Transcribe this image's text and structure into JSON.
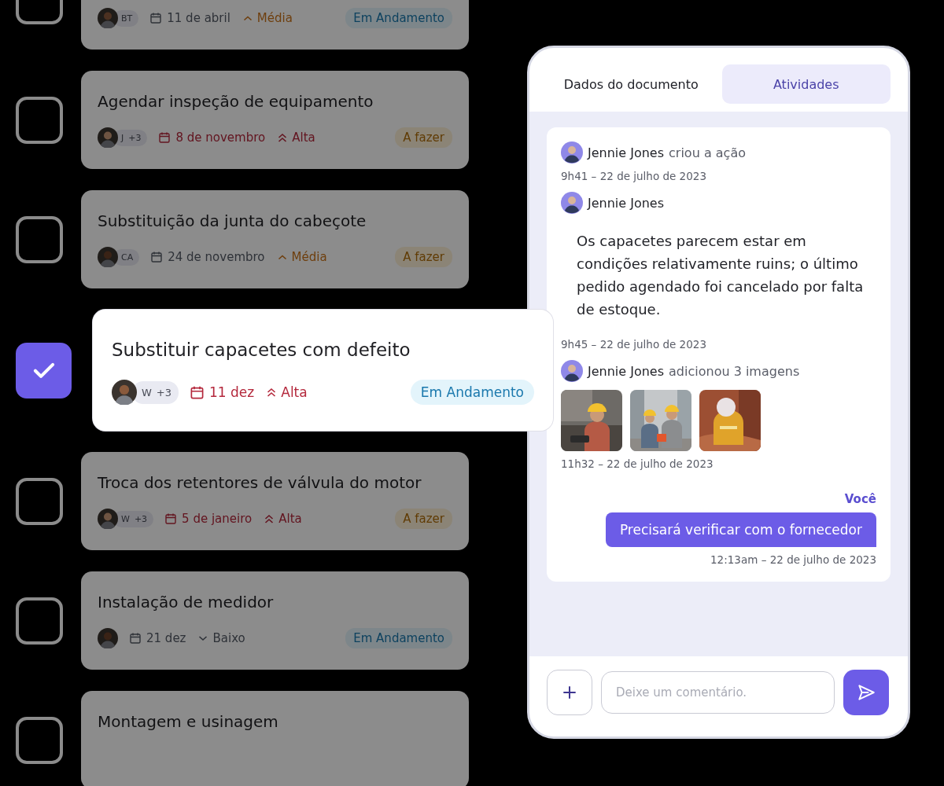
{
  "tasks": [
    {
      "checked": false,
      "selected": false,
      "assignee": {
        "initials": "BT"
      },
      "date": "11 de abril",
      "date_overdue": false,
      "priority": {
        "label": "Média",
        "kind": "medium"
      },
      "status": {
        "label": "Em Andamento",
        "kind": "in_progress"
      }
    },
    {
      "checked": false,
      "selected": false,
      "title": "Agendar inspeção de equipamento",
      "assignee": {
        "initials": "J",
        "extra": "+3"
      },
      "date": "8 de novembro",
      "date_overdue": true,
      "priority": {
        "label": "Alta",
        "kind": "high"
      },
      "status": {
        "label": "A fazer",
        "kind": "todo"
      }
    },
    {
      "checked": false,
      "selected": false,
      "title": "Substituição da junta do cabeçote",
      "assignee": {
        "initials": "CA"
      },
      "date": "24 de novembro",
      "date_overdue": false,
      "priority": {
        "label": "Média",
        "kind": "medium"
      },
      "status": {
        "label": "A fazer",
        "kind": "todo"
      }
    },
    {
      "checked": true,
      "selected": true,
      "title": "Substituir capacetes com defeito",
      "assignee": {
        "initials": "W",
        "extra": "+3"
      },
      "date": "11 dez",
      "date_overdue": true,
      "priority": {
        "label": "Alta",
        "kind": "high"
      },
      "status": {
        "label": "Em Andamento",
        "kind": "in_progress"
      }
    },
    {
      "checked": false,
      "selected": false,
      "title": "Troca dos retentores de válvula do motor",
      "assignee": {
        "initials": "W",
        "extra": "+3"
      },
      "date": "5 de janeiro",
      "date_overdue": true,
      "priority": {
        "label": "Alta",
        "kind": "high"
      },
      "status": {
        "label": "A fazer",
        "kind": "todo"
      }
    },
    {
      "checked": false,
      "selected": false,
      "title": "Instalação de medidor",
      "date": "21 dez",
      "date_overdue": false,
      "priority": {
        "label": "Baixo",
        "kind": "low"
      },
      "status": {
        "label": "Em Andamento",
        "kind": "in_progress"
      }
    },
    {
      "checked": false,
      "selected": false,
      "title": "Montagem e usinagem"
    }
  ],
  "panel": {
    "tabs": [
      {
        "label": "Dados do documento",
        "selected": false
      },
      {
        "label": "Atividades",
        "selected": true
      }
    ],
    "activity": [
      {
        "kind": "event",
        "author": "Jennie Jones",
        "action": "criou a ação",
        "time": "9h41 – 22 de julho de 2023"
      },
      {
        "kind": "comment",
        "author": "Jennie Jones",
        "text": "Os capacetes parecem estar em condições relativamente ruins; o último pedido agendado foi cancelado por falta de estoque.",
        "time": "9h45 – 22 de julho de 2023"
      },
      {
        "kind": "images",
        "author": "Jennie Jones",
        "action": "adicionou 3 imagens",
        "time": "11h32 – 22 de julho de 2023"
      }
    ],
    "own_message": {
      "author": "Você",
      "text": "Precisará verificar com o fornecedor",
      "time": "12:13am – 22 de julho de 2023"
    },
    "composer": {
      "placeholder": "Deixe um comentário."
    }
  }
}
